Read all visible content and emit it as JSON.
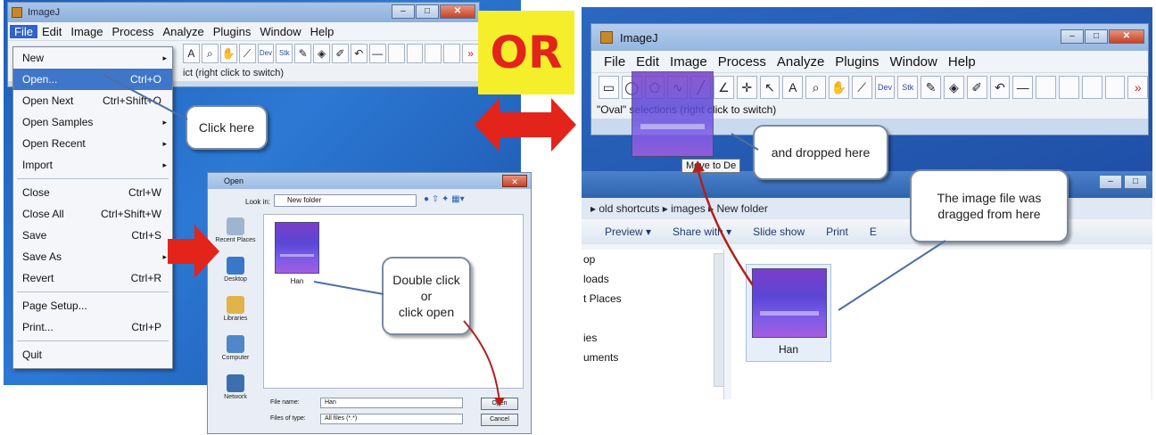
{
  "left": {
    "window_title": "ImageJ",
    "menu": [
      "File",
      "Edit",
      "Image",
      "Process",
      "Analyze",
      "Plugins",
      "Window",
      "Help"
    ],
    "status_text": "ict (right click to switch)",
    "file_menu": [
      {
        "label": "New",
        "shortcut": "",
        "submenu": true
      },
      {
        "label": "Open...",
        "shortcut": "Ctrl+O",
        "highlight": true
      },
      {
        "label": "Open Next",
        "shortcut": "Ctrl+Shift+O"
      },
      {
        "label": "Open Samples",
        "shortcut": "",
        "submenu": true
      },
      {
        "label": "Open Recent",
        "shortcut": "",
        "submenu": true
      },
      {
        "label": "Import",
        "shortcut": "",
        "submenu": true
      },
      {
        "sep": true
      },
      {
        "label": "Close",
        "shortcut": "Ctrl+W"
      },
      {
        "label": "Close All",
        "shortcut": "Ctrl+Shift+W"
      },
      {
        "label": "Save",
        "shortcut": "Ctrl+S"
      },
      {
        "label": "Save As",
        "shortcut": "",
        "submenu": true
      },
      {
        "label": "Revert",
        "shortcut": "Ctrl+R"
      },
      {
        "sep": true
      },
      {
        "label": "Page Setup...",
        "shortcut": ""
      },
      {
        "label": "Print...",
        "shortcut": "Ctrl+P"
      },
      {
        "sep": true
      },
      {
        "label": "Quit",
        "shortcut": ""
      }
    ],
    "callout_click": "Click here",
    "dialog": {
      "title": "Open",
      "look_in_label": "Look in:",
      "look_in_value": "New folder",
      "places": [
        "Recent Places",
        "Desktop",
        "Libraries",
        "Computer",
        "Network"
      ],
      "file_name": "Han",
      "file_name_label": "File name:",
      "file_name_value": "Han",
      "files_of_type_label": "Files of type:",
      "files_of_type_value": "All files (*.*)",
      "open_button": "Open",
      "cancel_button": "Cancel"
    },
    "callout_open": [
      "Double click",
      "or",
      "click open"
    ]
  },
  "or_label": "OR",
  "right": {
    "window_title": "ImageJ",
    "menu": [
      "File",
      "Edit",
      "Image",
      "Process",
      "Analyze",
      "Plugins",
      "Window",
      "Help"
    ],
    "status_text": "\"Oval\"                    selections (right click to switch)",
    "move_tooltip": "Move to De",
    "callout_dropped": "and dropped here",
    "callout_dragged": "The image file was dragged from here",
    "address": "▸  old shortcuts  ▸  images  ▸  New folder",
    "toolbar": [
      "Preview ▾",
      "Share with ▾",
      "Slide show",
      "Print",
      "E"
    ],
    "nav_items": [
      "op",
      "loads",
      "t Places",
      "",
      "ies",
      "uments"
    ],
    "file_name": "Han"
  },
  "colors": {
    "accent_red": "#e3241a",
    "or_bg": "#f5ee2a",
    "menu_highlight": "#3f76c9"
  }
}
